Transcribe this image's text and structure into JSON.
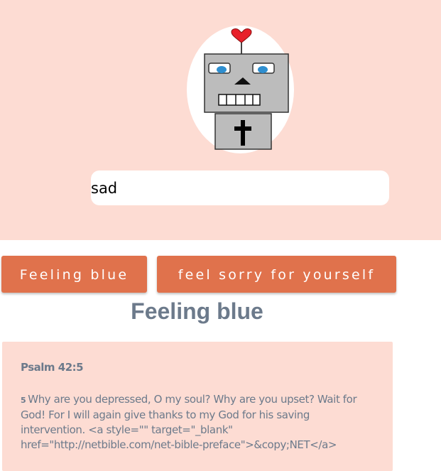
{
  "header": {
    "mascot": "robot-heart-cross-icon",
    "search": {
      "value": "sad",
      "placeholder": ""
    }
  },
  "topics": [
    {
      "label": "Feeling blue"
    },
    {
      "label": "feel sorry for yourself"
    }
  ],
  "results": {
    "title": "Feeling blue",
    "verses": [
      {
        "reference": "Psalm 42:5",
        "number": "5",
        "text": "Why are you depressed, O my soul? Why are you upset? Wait for God! For I will again give thanks to my God for his saving intervention. <a style=\"\" target=\"_blank\" href=\"http://netbible.com/net-bible-preface\">&copy;NET</a>"
      }
    ]
  },
  "colors": {
    "hero_bg": "#fddcd3",
    "accent": "#e0724c",
    "text_muted": "#6c7a8b"
  }
}
